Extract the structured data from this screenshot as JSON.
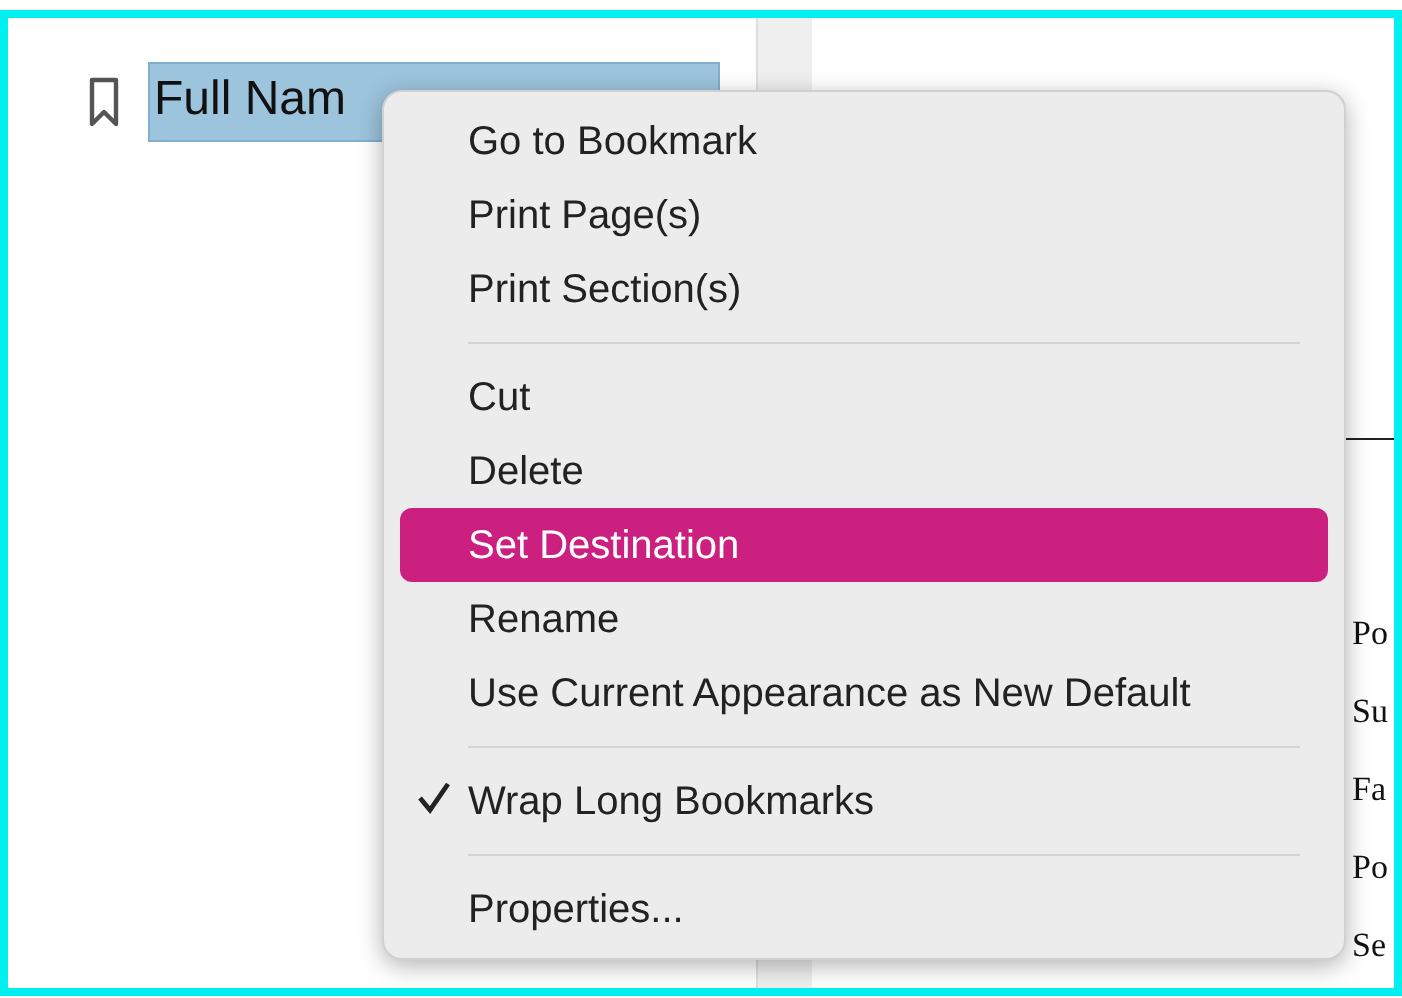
{
  "bookmarks": [
    {
      "label": "Full Nam",
      "selected": true
    }
  ],
  "document": {
    "lines": [
      "Po",
      "Su",
      "Fa",
      "Po",
      "Se"
    ]
  },
  "context_menu": {
    "groups": [
      [
        {
          "label": "Go to Bookmark",
          "selected": false,
          "checked": false
        },
        {
          "label": "Print Page(s)",
          "selected": false,
          "checked": false
        },
        {
          "label": "Print Section(s)",
          "selected": false,
          "checked": false
        }
      ],
      [
        {
          "label": "Cut",
          "selected": false,
          "checked": false
        },
        {
          "label": "Delete",
          "selected": false,
          "checked": false
        },
        {
          "label": "Set Destination",
          "selected": true,
          "checked": false
        },
        {
          "label": "Rename",
          "selected": false,
          "checked": false
        },
        {
          "label": "Use Current Appearance as New Default",
          "selected": false,
          "checked": false
        }
      ],
      [
        {
          "label": "Wrap Long Bookmarks",
          "selected": false,
          "checked": true
        }
      ],
      [
        {
          "label": "Properties...",
          "selected": false,
          "checked": false
        }
      ]
    ]
  }
}
